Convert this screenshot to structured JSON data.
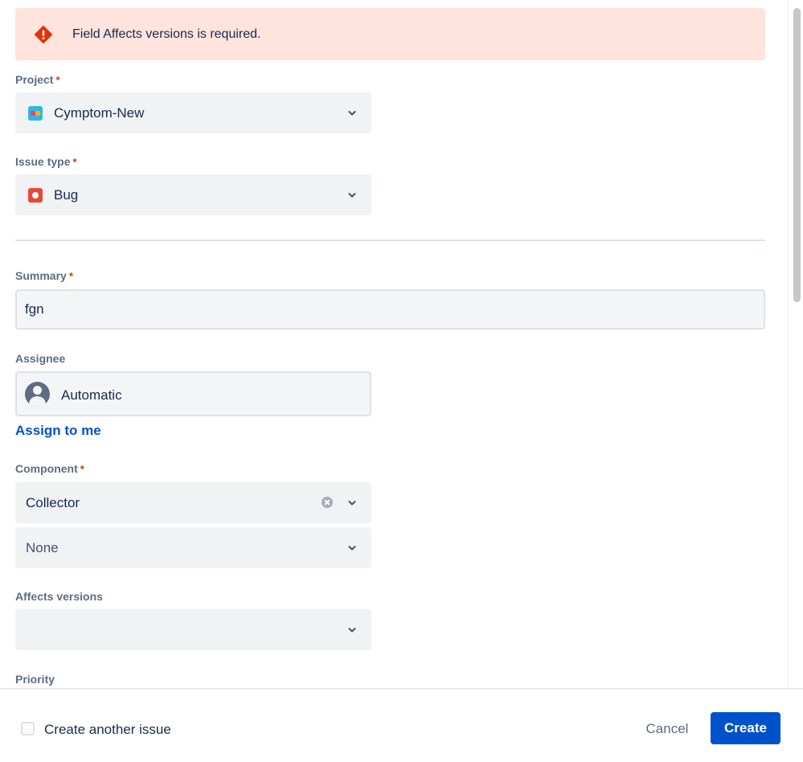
{
  "banner": {
    "message": "Field Affects versions is required.",
    "icon": "error-diamond-icon",
    "color": "#ffe3dd"
  },
  "form": {
    "required_marker": "*",
    "project": {
      "label": "Project",
      "value": "Cymptom-New"
    },
    "issue_type": {
      "label": "Issue type",
      "value": "Bug"
    },
    "summary": {
      "label": "Summary",
      "value": "fgn"
    },
    "assignee": {
      "label": "Assignee",
      "value": "Automatic",
      "assign_to_me": "Assign to me"
    },
    "component": {
      "label": "Component",
      "value": "Collector",
      "second_value": "None"
    },
    "affects_versions": {
      "label": "Affects versions",
      "value": ""
    },
    "priority": {
      "label": "Priority"
    }
  },
  "footer": {
    "create_another_label": "Create another issue",
    "create_another_checked": false,
    "cancel_label": "Cancel",
    "create_label": "Create"
  },
  "colors": {
    "primary": "#0052cc",
    "required": "#de350b",
    "error_bg": "#ffe3dd"
  }
}
